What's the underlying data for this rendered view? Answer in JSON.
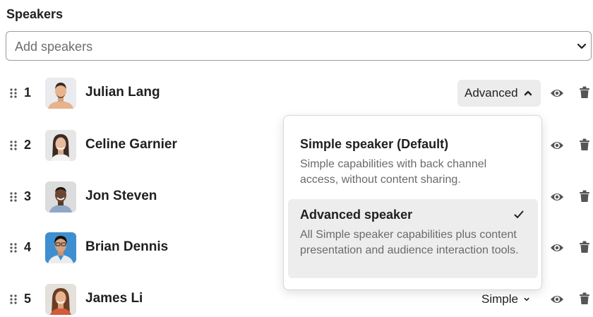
{
  "section": {
    "title": "Speakers"
  },
  "add_speakers": {
    "placeholder": "Add speakers"
  },
  "speakers": [
    {
      "index": "1",
      "name": "Julian Lang",
      "role": "Advanced"
    },
    {
      "index": "2",
      "name": "Celine Garnier"
    },
    {
      "index": "3",
      "name": "Jon Steven"
    },
    {
      "index": "4",
      "name": "Brian Dennis"
    },
    {
      "index": "5",
      "name": "James Li",
      "role": "Simple"
    }
  ],
  "role_dropdown": {
    "options": [
      {
        "title": "Simple speaker (Default)",
        "description": "Simple capabilities with back channel access, without content sharing.",
        "selected": false
      },
      {
        "title": "Advanced speaker",
        "description": "All Simple speaker capabilities plus content presentation and audience interaction tools.",
        "selected": true
      }
    ]
  },
  "colors": {
    "text": "#1f1f1f",
    "muted": "#6a6a6a",
    "selected_bg": "#ededed",
    "button_bg": "#ececec"
  },
  "icons": [
    "drag-handle-icon",
    "chevron-down-icon",
    "chevron-up-icon",
    "eye-icon",
    "trash-icon",
    "checkmark-icon"
  ]
}
